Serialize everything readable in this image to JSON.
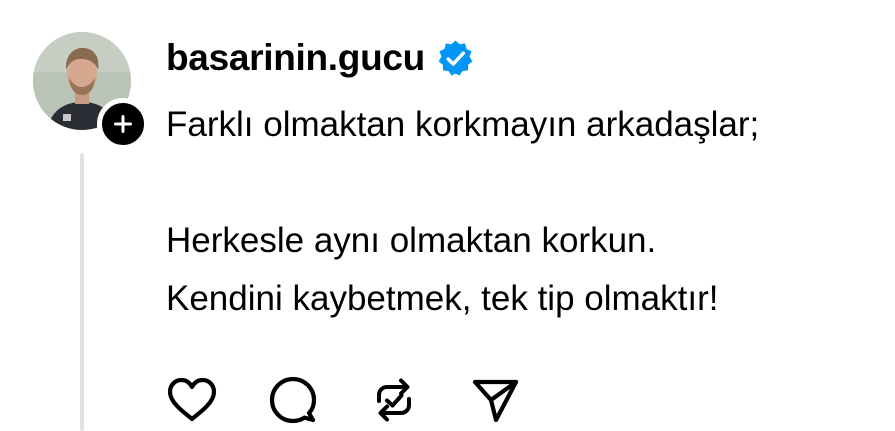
{
  "post": {
    "username": "basarinin.gucu",
    "verified": true,
    "text_lines": [
      "Farklı olmaktan korkmayın arkadaşlar;",
      "",
      "Herkesle aynı olmaktan korkun.",
      "Kendini kaybetmek, tek tip olmaktır!"
    ]
  },
  "icons": {
    "verified": "verified-badge-icon",
    "follow": "plus-icon",
    "like": "heart-icon",
    "comment": "comment-bubble-icon",
    "repost": "repost-icon",
    "share": "send-icon"
  },
  "colors": {
    "verified_blue": "#0095f6",
    "text": "#000000",
    "thread_line": "#e2e2e2"
  }
}
